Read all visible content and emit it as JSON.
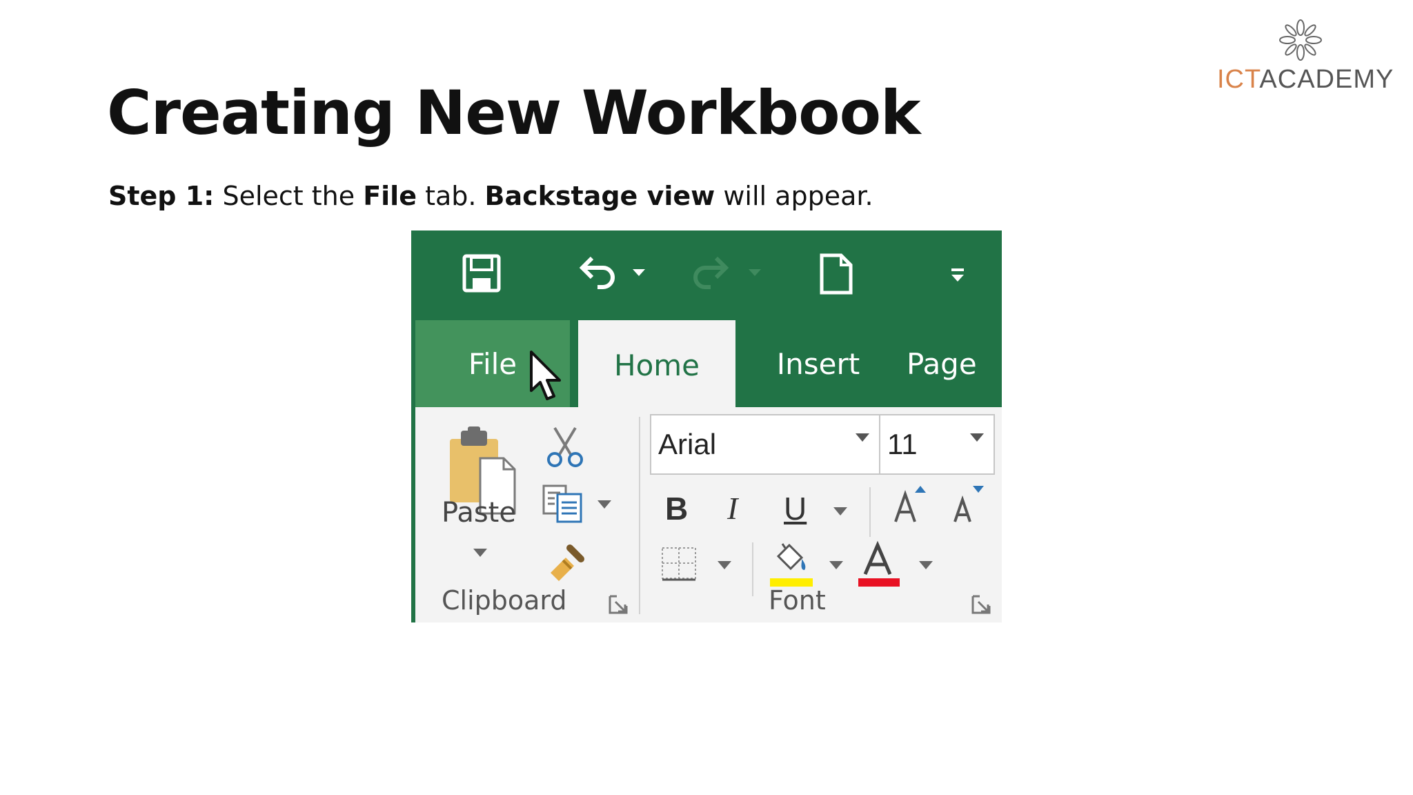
{
  "logo": {
    "part1": "ICT",
    "part2": "ACADEMY"
  },
  "title": "Creating New Workbook",
  "step": {
    "label": "Step 1:",
    "text1": " Select the ",
    "bold1": "File",
    "text2": " tab. ",
    "bold2": "Backstage view",
    "text3": " will appear."
  },
  "ribbon": {
    "tabs": {
      "file": "File",
      "home": "Home",
      "insert": "Insert",
      "page": "Page"
    },
    "clipboard": {
      "paste": "Paste",
      "group_label": "Clipboard"
    },
    "font": {
      "name": "Arial",
      "size": "11",
      "group_label": "Font",
      "bold": "B",
      "italic": "I",
      "underline": "U"
    },
    "colors": {
      "accent": "#217346",
      "file_tab": "#43935c",
      "highlight": "#ffee00",
      "font_color": "#e81123"
    }
  }
}
